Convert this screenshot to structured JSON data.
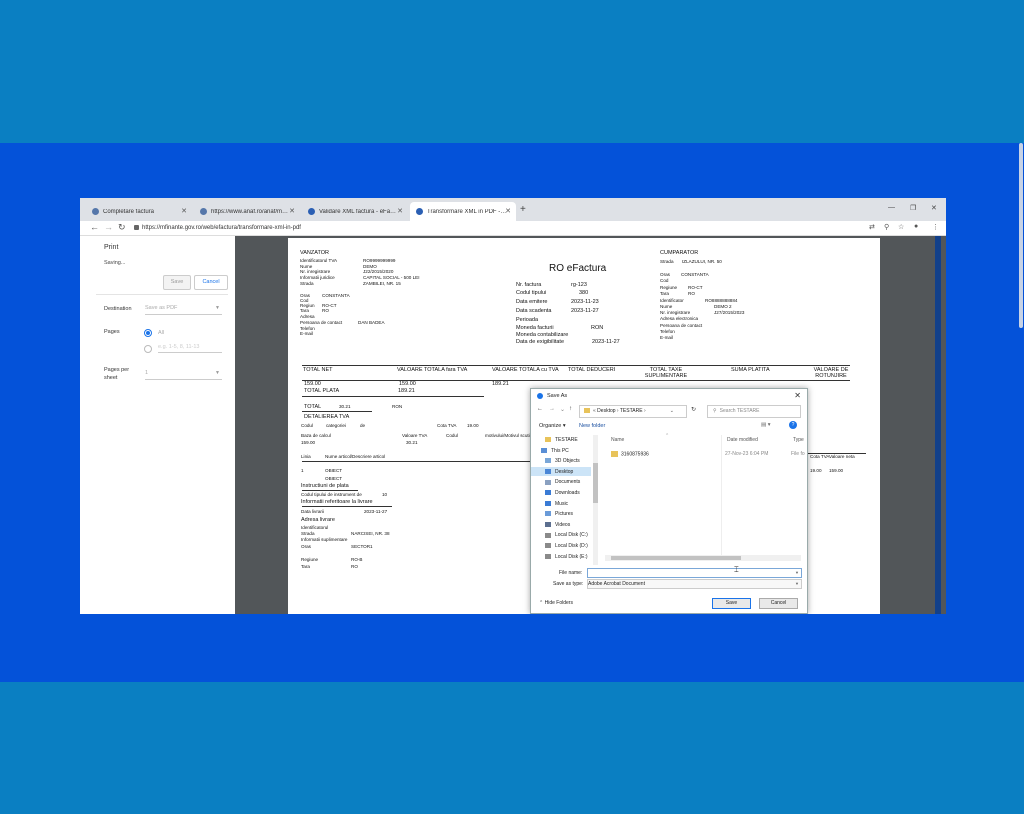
{
  "colors": {
    "outer_bg": "#0a7fc2",
    "band_bg": "#0452d9",
    "accent": "#1a73e8"
  },
  "tabs": [
    {
      "label": "Completare factura",
      "icon": "shield-icon"
    },
    {
      "label": "https://www.anaf.ro/anaf/myvra...",
      "icon": "shield-icon"
    },
    {
      "label": "Validare XML factură - eFactura",
      "icon": "efactura-icon"
    },
    {
      "label": "Transformare XML in PDF - eFactura",
      "icon": "efactura-icon",
      "active": true
    }
  ],
  "address": {
    "url": "https://mfinante.gov.ro/web/efactura/transformare-xml-in-pdf"
  },
  "print": {
    "title": "Print",
    "status": "Saving...",
    "save_label": "Save",
    "cancel_label": "Cancel",
    "destination_label": "Destination",
    "destination_value": "Save as PDF",
    "pages_label": "Pages",
    "pages_all": "All",
    "pages_custom_placeholder": "e.g. 1-5, 8, 11-13",
    "pages_per_sheet_label": "Pages per sheet",
    "pages_per_sheet_value": "1"
  },
  "invoice": {
    "title": "RO eFactura",
    "seller": {
      "heading": "VANZATOR",
      "rows": [
        [
          "Identificatorul TVA",
          "RO9999999999"
        ],
        [
          "Nume",
          "DEMO"
        ],
        [
          "Nr. inregistrare",
          "J22/2015/2020"
        ],
        [
          "Informatii juridice",
          "CAPITAL SOCIAL - 500 LEI"
        ],
        [
          "Strada",
          "ZAMBILEI, NR. 15"
        ],
        [
          "Oras",
          "CONSTANTA"
        ],
        [
          "Cod",
          ""
        ],
        [
          "Regiun",
          "RO-CT"
        ],
        [
          "Tara",
          "RO"
        ],
        [
          "Adresa",
          ""
        ],
        [
          "Persoana de contact",
          "DAN BADEA"
        ],
        [
          "Telefon",
          ""
        ],
        [
          "E-mail",
          ""
        ]
      ]
    },
    "details": [
      [
        "Nr. factura",
        "rg-123"
      ],
      [
        "Codul tipului",
        "380"
      ],
      [
        "Data emitere",
        "2023-11-23"
      ],
      [
        "Data scadenta",
        "2023-11-27"
      ],
      [
        "Perioada",
        ""
      ],
      [
        "Moneda facturii",
        "RON"
      ],
      [
        "Moneda contabilizare",
        ""
      ],
      [
        "Data de exigibilitate",
        "2023-11-27"
      ]
    ],
    "buyer": {
      "heading": "CUMPARATOR",
      "rows": [
        [
          "Strada",
          "IZLAZULUI, NR. 50"
        ],
        [
          "Oras",
          "CONSTANTA"
        ],
        [
          "Cod",
          ""
        ],
        [
          "Regiune",
          "RO-CT"
        ],
        [
          "Tara",
          "RO"
        ],
        [
          "Identificator",
          "RO8888888884"
        ],
        [
          "Nume",
          "DEMO 2"
        ],
        [
          "Nr. inregistrare",
          "J27/2015/2023"
        ],
        [
          "Adresa electronica",
          ""
        ],
        [
          "Persoana de contact",
          ""
        ],
        [
          "Telefon",
          ""
        ],
        [
          "E-mail",
          ""
        ]
      ]
    },
    "totals_headers": [
      "TOTAL NET",
      "VALOARE TOTALA fara TVA",
      "VALOARE TOTALA cu TVA",
      "TOTAL DEDUCERI",
      "TOTAL TAXE SUPLIMENTARE",
      "SUMA PLATITA",
      "VALOARE DE ROTUNJIRE"
    ],
    "totals_values": [
      "159.00",
      "159.00",
      "189.21"
    ],
    "total_plata_label": "TOTAL PLATA",
    "total_plata_value": "189.21",
    "total_label": "TOTAL",
    "total_tva": "30.21",
    "total_currency": "RON",
    "detaliere_heading": "DETALIEREA TVA",
    "detaliere_row1": [
      "Codul",
      "categoriei",
      "de",
      "Cota TVA",
      "19.00"
    ],
    "detaliere_row2": [
      "Baza de calcul",
      "Valoare TVA",
      "Codul",
      "motivului/Motivul scutirii"
    ],
    "detaliere_vals": [
      "159.00",
      "30.21"
    ],
    "line_header": [
      "Linia",
      "Nume articol/Descriere articol"
    ],
    "line_right_header": [
      "Cota TVA",
      "Valoare neta"
    ],
    "line_right_vals": [
      "19.00",
      "159.00"
    ],
    "line_rows": [
      [
        "1",
        "OBIECT"
      ],
      [
        "",
        "OBIECT"
      ]
    ],
    "instructiuni_heading": "Instructiuni de plata",
    "instructiuni_row": [
      "Codul tipului de instrument de",
      "10"
    ],
    "referinte_heading": "Informatii referitoare la livrare",
    "data_livrare": [
      "Data livrarii",
      "2023-11-27"
    ],
    "adresa_heading": "Adresa livrare",
    "adresa_rows": [
      [
        "Identificatorul",
        ""
      ],
      [
        "Strada",
        "NARCISEI, NR. 38"
      ],
      [
        "Informatii suplimentare",
        ""
      ],
      [
        "Oras",
        "SECTOR1"
      ],
      [
        "",
        ""
      ],
      [
        "Regiune",
        "RO-B"
      ],
      [
        "Tara",
        "RO"
      ]
    ]
  },
  "save_dialog": {
    "title": "Save As",
    "breadcrumb": [
      "Desktop",
      "TESTARE"
    ],
    "search_placeholder": "Search TESTARE",
    "organize_label": "Organize",
    "new_folder_label": "New folder",
    "tree": [
      {
        "label": "TESTARE",
        "icon": "folder-icon"
      },
      {
        "label": "This PC",
        "icon": "computer-icon"
      },
      {
        "label": "3D Objects",
        "icon": "cube-icon"
      },
      {
        "label": "Desktop",
        "icon": "desktop-icon",
        "selected": true
      },
      {
        "label": "Documents",
        "icon": "document-icon"
      },
      {
        "label": "Downloads",
        "icon": "download-icon"
      },
      {
        "label": "Music",
        "icon": "music-icon"
      },
      {
        "label": "Pictures",
        "icon": "picture-icon"
      },
      {
        "label": "Videos",
        "icon": "video-icon"
      },
      {
        "label": "Local Disk (C:)",
        "icon": "disk-icon"
      },
      {
        "label": "Local Disk (D:)",
        "icon": "disk-icon"
      },
      {
        "label": "Local Disk (E:)",
        "icon": "disk-icon"
      }
    ],
    "columns": [
      "Name",
      "Date modified",
      "Type"
    ],
    "files": [
      {
        "name": "3160875936",
        "date": "27-Nov-23 6:04 PM",
        "type": "File fo"
      }
    ],
    "file_name_label": "File name:",
    "file_name_value": "",
    "save_type_label": "Save as type:",
    "save_type_value": "Adobe Acrobat Document",
    "hide_folders_label": "Hide Folders",
    "save_label": "Save",
    "cancel_label": "Cancel"
  }
}
